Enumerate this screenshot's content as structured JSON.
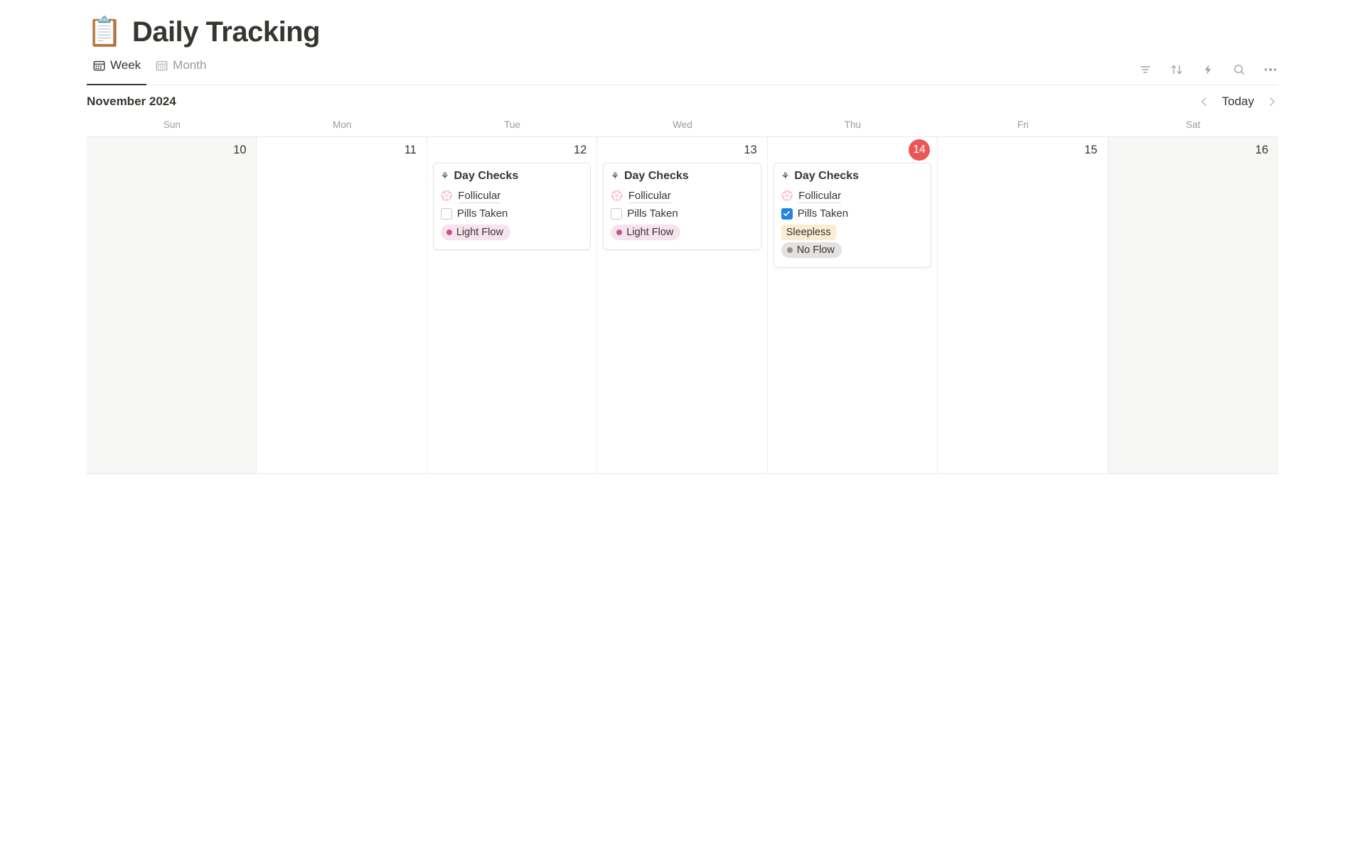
{
  "page": {
    "emoji": "📋",
    "title": "Daily Tracking"
  },
  "views": {
    "tabs": [
      {
        "label": "Week",
        "icon": "calendar-week-icon",
        "active": true
      },
      {
        "label": "Month",
        "icon": "calendar-month-icon",
        "active": false
      }
    ]
  },
  "toolbar": {
    "filter_label": "Filter",
    "sort_label": "Sort",
    "automation_label": "Automations",
    "search_label": "Search",
    "more_label": "More options",
    "icon_color": "#a5a49f"
  },
  "calendar": {
    "month_label": "November 2024",
    "prev_label": "‹",
    "today_label": "Today",
    "next_label": "›",
    "today_accent": "#eb5757",
    "weekend_bg": "#f7f7f5",
    "weekday_headers": [
      "Sun",
      "Mon",
      "Tue",
      "Wed",
      "Thu",
      "Fri",
      "Sat"
    ],
    "days": [
      {
        "daynum": "10",
        "weekday": "Sun",
        "weekend": true,
        "today": false,
        "events": []
      },
      {
        "daynum": "11",
        "weekday": "Mon",
        "weekend": false,
        "today": false,
        "events": []
      },
      {
        "daynum": "12",
        "weekday": "Tue",
        "weekend": false,
        "today": false,
        "events": [
          {
            "icon": "⚘",
            "title": "Day Checks",
            "relation": {
              "emoji": "💮",
              "text": "Follicular"
            },
            "checkbox": {
              "label": "Pills Taken",
              "checked": false
            },
            "tags": [
              {
                "text": "Light Flow",
                "dot": "#c4588c",
                "bg": "#f7e3ed",
                "shape": "pill"
              }
            ]
          }
        ]
      },
      {
        "daynum": "13",
        "weekday": "Wed",
        "weekend": false,
        "today": false,
        "events": [
          {
            "icon": "⚘",
            "title": "Day Checks",
            "relation": {
              "emoji": "💮",
              "text": "Follicular"
            },
            "checkbox": {
              "label": "Pills Taken",
              "checked": false
            },
            "tags": [
              {
                "text": "Light Flow",
                "dot": "#c4588c",
                "bg": "#f7e3ed",
                "shape": "pill"
              }
            ]
          }
        ]
      },
      {
        "daynum": "14",
        "weekday": "Thu",
        "weekend": false,
        "today": true,
        "events": [
          {
            "icon": "⚘",
            "title": "Day Checks",
            "relation": {
              "emoji": "💮",
              "text": "Follicular"
            },
            "checkbox": {
              "label": "Pills Taken",
              "checked": true
            },
            "tags": [
              {
                "text": "Sleepless",
                "dot": null,
                "bg": "#fbecd2",
                "shape": "square"
              },
              {
                "text": "No Flow",
                "dot": "#8f8f8c",
                "bg": "#e3e2e0",
                "shape": "pill"
              }
            ]
          }
        ]
      },
      {
        "daynum": "15",
        "weekday": "Fri",
        "weekend": false,
        "today": false,
        "events": []
      },
      {
        "daynum": "16",
        "weekday": "Sat",
        "weekend": true,
        "today": false,
        "events": []
      }
    ]
  }
}
